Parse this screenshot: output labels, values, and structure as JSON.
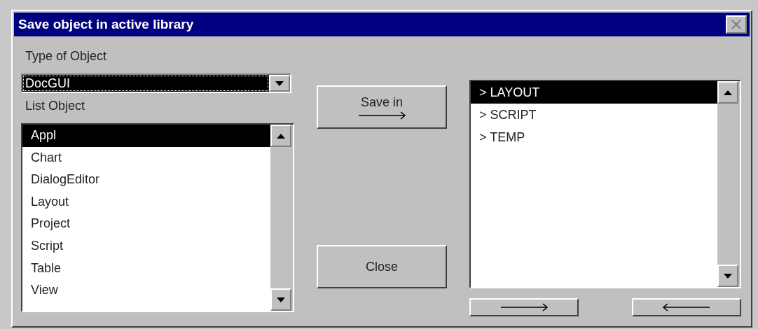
{
  "window": {
    "title": "Save object in active library"
  },
  "type_label": "Type of Object",
  "type_combo": {
    "value": "DocGUI"
  },
  "list_label": "List Object",
  "objects": [
    {
      "label": "Appl",
      "selected": true
    },
    {
      "label": "Chart",
      "selected": false
    },
    {
      "label": "DialogEditor",
      "selected": false
    },
    {
      "label": "Layout",
      "selected": false
    },
    {
      "label": "Project",
      "selected": false
    },
    {
      "label": "Script",
      "selected": false
    },
    {
      "label": "Table",
      "selected": false
    },
    {
      "label": "View",
      "selected": false
    }
  ],
  "buttons": {
    "save": "Save in",
    "close": "Close"
  },
  "libraries": [
    {
      "label": "> LAYOUT",
      "selected": true
    },
    {
      "label": "> SCRIPT",
      "selected": false
    },
    {
      "label": "> TEMP",
      "selected": false
    }
  ]
}
